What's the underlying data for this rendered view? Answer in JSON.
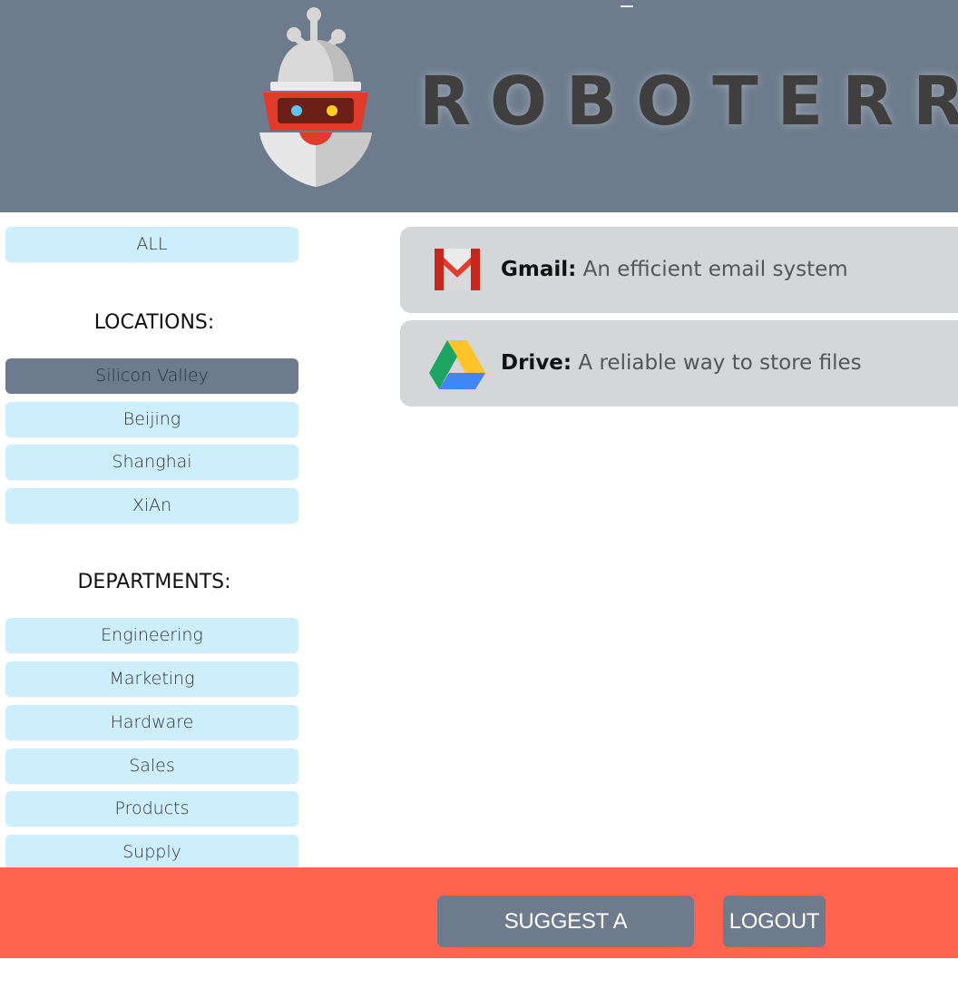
{
  "header": {
    "brand": "ROBOTERRA",
    "logo_icon": "robot-logo-icon"
  },
  "sidebar": {
    "all_label": "ALL",
    "locations_title": "LOCATIONS:",
    "locations": [
      {
        "label": "Silicon Valley",
        "active": true
      },
      {
        "label": "Beijing",
        "active": false
      },
      {
        "label": "Shanghai",
        "active": false
      },
      {
        "label": "XiAn",
        "active": false
      }
    ],
    "departments_title": "DEPARTMENTS:",
    "departments": [
      {
        "label": "Engineering"
      },
      {
        "label": "Marketing"
      },
      {
        "label": "Hardware"
      },
      {
        "label": "Sales"
      },
      {
        "label": "Products"
      },
      {
        "label": "Supply"
      }
    ]
  },
  "resources": [
    {
      "name": "Gmail:",
      "description": "An efficient email system",
      "icon": "gmail-icon"
    },
    {
      "name": "Drive:",
      "description": "A reliable way to store files",
      "icon": "google-drive-icon"
    }
  ],
  "footer": {
    "suggest_label": "SUGGEST A RESOURCE?",
    "logout_label": "LOGOUT"
  },
  "colors": {
    "header_bg": "#6e7b8c",
    "nav_button": "#cceefd",
    "nav_active": "#6e7b8c",
    "card_bg": "#d3d7d8",
    "footer_bg": "#ff6450",
    "brand_text": "#3f3f3f"
  }
}
